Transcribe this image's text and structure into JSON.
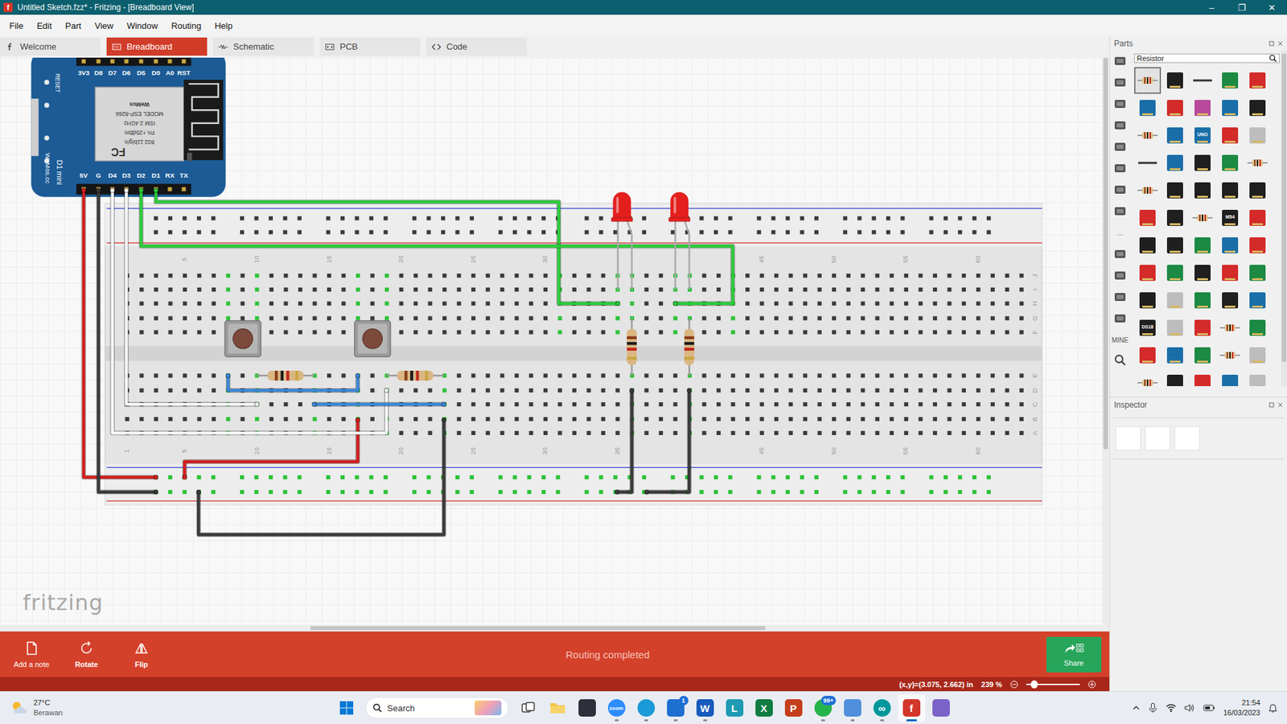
{
  "window": {
    "title": "Untitled Sketch.fzz* - Fritzing - [Breadboard View]",
    "app_icon": "f",
    "controls": [
      "–",
      "❐",
      "✕"
    ]
  },
  "menu": [
    "File",
    "Edit",
    "Part",
    "View",
    "Window",
    "Routing",
    "Help"
  ],
  "tabs": [
    {
      "label": "Welcome",
      "selected": false
    },
    {
      "label": "Breadboard",
      "selected": true
    },
    {
      "label": "Schematic",
      "selected": false
    },
    {
      "label": "PCB",
      "selected": false
    },
    {
      "label": "Code",
      "selected": false
    }
  ],
  "canvas": {
    "watermark": "fritzing",
    "v_scroll": {
      "start": 0,
      "size": 0.69
    },
    "h_scroll": {
      "start": 0.28,
      "size": 0.41
    },
    "board": {
      "reset": "RESET",
      "name": "D1 mini",
      "site": "WeMos.cc",
      "top_pins": [
        "3V3",
        "D8",
        "D7",
        "D6",
        "D5",
        "D0",
        "A0",
        "RST"
      ],
      "bottom_pins": [
        "5V",
        "G",
        "D4",
        "D3",
        "D2",
        "D1",
        "RX",
        "TX"
      ],
      "chip_lines": [
        "FC",
        "802.11b/g/n",
        "PA +25dBm",
        "ISM 2.4GHz",
        "MODEL ESP-8266",
        "WeMos"
      ]
    },
    "breadboard": {
      "top_numbers": [
        "5",
        "10",
        "15",
        "20",
        "25",
        "30",
        "45",
        "50",
        "55",
        "60"
      ],
      "bottom_numbers": [
        "1",
        "5",
        "10",
        "15",
        "20",
        "25",
        "30",
        "35",
        "45",
        "50",
        "55",
        "60"
      ],
      "top_rows": [
        "J",
        "I",
        "H",
        "G",
        "F"
      ],
      "bottom_rows": [
        "E",
        "D",
        "C",
        "B",
        "A"
      ],
      "connected_top": [
        8,
        10,
        17,
        19,
        31,
        35,
        36,
        39,
        40,
        43
      ],
      "connected_bottom": [
        8,
        10,
        14,
        17,
        19,
        23,
        36,
        40
      ],
      "top_rail_connected": false,
      "bottom_rail_connected": true
    },
    "wires": [
      {
        "color": "#d41e1e"
      },
      {
        "color": "#d41e1e"
      },
      {
        "color": "#3a3a3a"
      },
      {
        "color": "#3a3a3a"
      },
      {
        "color": "#3a3a3a"
      },
      {
        "color": "#3a3a3a"
      },
      {
        "color": "#f6f6f6"
      },
      {
        "color": "#f6f6f6"
      },
      {
        "color": "#2bcc3a"
      },
      {
        "color": "#2bcc3a"
      },
      {
        "color": "#3a87d8"
      },
      {
        "color": "#3a87d8"
      }
    ],
    "leds": [
      {
        "color": "#e3201e"
      },
      {
        "color": "#e3201e"
      }
    ]
  },
  "toolbar": {
    "buttons": [
      {
        "label": "Add a note"
      },
      {
        "label": "Rotate"
      },
      {
        "label": "Flip"
      }
    ],
    "status": "Routing completed",
    "share": "Share"
  },
  "status_bar": {
    "coordinates": "(x,y)=(3.075, 2.662) in",
    "zoom": "239 %",
    "zoom_level": 0.15
  },
  "parts": {
    "title": "Parts",
    "search": "Resistor",
    "bins": [
      {
        "kind": "icon"
      },
      {
        "kind": "icon"
      },
      {
        "kind": "icon"
      },
      {
        "kind": "icon"
      },
      {
        "kind": "icon"
      },
      {
        "kind": "icon"
      },
      {
        "kind": "icon"
      },
      {
        "kind": "icon"
      },
      {
        "kind": "text",
        "label": "…"
      },
      {
        "kind": "icon"
      },
      {
        "kind": "icon"
      },
      {
        "kind": "icon"
      },
      {
        "kind": "icon"
      },
      {
        "kind": "text",
        "label": "MINE"
      },
      {
        "kind": "search"
      }
    ],
    "results": [
      {
        "kind": "resistor",
        "selected": true
      },
      {
        "kind": "black",
        "selected": false
      },
      {
        "kind": "wire",
        "selected": false
      },
      {
        "kind": "green",
        "selected": false
      },
      {
        "kind": "red",
        "selected": false
      },
      {
        "kind": "blue",
        "selected": false
      },
      {
        "kind": "red",
        "selected": false
      },
      {
        "kind": "purple",
        "selected": false
      },
      {
        "kind": "blue",
        "selected": false
      },
      {
        "kind": "black",
        "selected": false
      },
      {
        "kind": "resistor",
        "selected": false
      },
      {
        "kind": "blue",
        "selected": false
      },
      {
        "kind": "blue",
        "selected": false,
        "text": "UNO"
      },
      {
        "kind": "red",
        "selected": false
      },
      {
        "kind": "grey",
        "selected": false
      },
      {
        "kind": "wire",
        "selected": false
      },
      {
        "kind": "blue",
        "selected": false
      },
      {
        "kind": "black",
        "selected": false
      },
      {
        "kind": "green",
        "selected": false
      },
      {
        "kind": "resistor",
        "selected": false
      },
      {
        "kind": "resistor",
        "selected": false
      },
      {
        "kind": "black",
        "selected": false
      },
      {
        "kind": "black",
        "selected": false
      },
      {
        "kind": "black",
        "selected": false
      },
      {
        "kind": "black",
        "selected": false
      },
      {
        "kind": "red",
        "selected": false
      },
      {
        "kind": "black",
        "selected": false
      },
      {
        "kind": "resistor",
        "selected": false
      },
      {
        "kind": "black",
        "selected": false,
        "text": "M54"
      },
      {
        "kind": "red",
        "selected": false
      },
      {
        "kind": "black",
        "selected": false
      },
      {
        "kind": "black",
        "selected": false
      },
      {
        "kind": "green",
        "selected": false
      },
      {
        "kind": "blue",
        "selected": false
      },
      {
        "kind": "red",
        "selected": false
      },
      {
        "kind": "red",
        "selected": false
      },
      {
        "kind": "green",
        "selected": false
      },
      {
        "kind": "black",
        "selected": false
      },
      {
        "kind": "red",
        "selected": false
      },
      {
        "kind": "green",
        "selected": false
      },
      {
        "kind": "black",
        "selected": false
      },
      {
        "kind": "grey",
        "selected": false
      },
      {
        "kind": "green",
        "selected": false
      },
      {
        "kind": "black",
        "selected": false
      },
      {
        "kind": "blue",
        "selected": false
      },
      {
        "kind": "black",
        "selected": false,
        "text": "DS18"
      },
      {
        "kind": "grey",
        "selected": false
      },
      {
        "kind": "red",
        "selected": false
      },
      {
        "kind": "resistor",
        "selected": false
      },
      {
        "kind": "green",
        "selected": false
      },
      {
        "kind": "red",
        "selected": false
      },
      {
        "kind": "blue",
        "selected": false
      },
      {
        "kind": "green",
        "selected": false
      },
      {
        "kind": "resistor",
        "selected": false
      },
      {
        "kind": "grey",
        "selected": false
      },
      {
        "kind": "resistor",
        "selected": false
      },
      {
        "kind": "black",
        "selected": false
      },
      {
        "kind": "red",
        "selected": false
      },
      {
        "kind": "blue",
        "selected": false
      },
      {
        "kind": "grey",
        "selected": false
      }
    ]
  },
  "inspector": {
    "title": "Inspector"
  },
  "taskbar": {
    "weather": {
      "temp": "27°C",
      "desc": "Berawan"
    },
    "search": "Search",
    "apps": [
      {
        "kind": "taskview",
        "color": "#3b3b3b",
        "running": false,
        "selected": false
      },
      {
        "kind": "folder",
        "color": "#f2c443",
        "running": false,
        "selected": false
      },
      {
        "kind": "tile",
        "color": "#2d2f3a",
        "running": false,
        "selected": false
      },
      {
        "kind": "circle",
        "color": "#2d8cff",
        "glyph": "zoom",
        "running": true,
        "selected": false
      },
      {
        "kind": "circle",
        "color": "#1a9ad6",
        "running": true,
        "selected": false
      },
      {
        "kind": "tile",
        "color": "#1e6fd0",
        "running": true,
        "selected": false,
        "badge": "1"
      },
      {
        "kind": "tile",
        "color": "#185abd",
        "glyph": "W",
        "running": true,
        "selected": false
      },
      {
        "kind": "tile",
        "color": "#1e9bb3",
        "glyph": "L",
        "running": false,
        "selected": false
      },
      {
        "kind": "tile",
        "color": "#107c41",
        "glyph": "X",
        "running": false,
        "selected": false
      },
      {
        "kind": "tile",
        "color": "#c43e1c",
        "glyph": "P",
        "running": false,
        "selected": false
      },
      {
        "kind": "circle",
        "color": "#25b34b",
        "running": true,
        "selected": false,
        "badge": "99+"
      },
      {
        "kind": "tile",
        "color": "#4f8fdc",
        "running": true,
        "selected": false
      },
      {
        "kind": "circle",
        "color": "#00979c",
        "glyph": "∞",
        "running": true,
        "selected": false
      },
      {
        "kind": "tile",
        "color": "#d3352a",
        "glyph": "f",
        "running": true,
        "selected": true
      },
      {
        "kind": "tile",
        "color": "#7a62c9",
        "running": false,
        "selected": false
      }
    ],
    "clock": {
      "time": "21:54",
      "date": "16/03/2023"
    }
  }
}
